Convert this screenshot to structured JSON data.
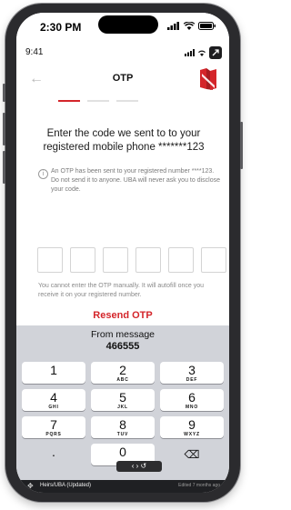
{
  "device": {
    "time": "2:30 PM"
  },
  "app_status": {
    "time": "9:41"
  },
  "header": {
    "back_icon": "back-arrow-icon",
    "title": "OTP",
    "logo_icon": "uba-logo-icon",
    "brand_color": "#d4252a"
  },
  "progress": {
    "steps": 3,
    "active_step": 1
  },
  "content": {
    "heading": "Enter the code we sent to to your registered mobile phone *******123",
    "info_text": "An OTP has been sent to your registered number ****123. Do not send it to anyone. UBA will never ask you to disclose your code.",
    "otp_length": 6,
    "note": "You cannot enter the OTP manually. It will autofill once you receive it on your registered number.",
    "resend_label": "Resend OTP"
  },
  "keyboard": {
    "suggestion_label": "From message",
    "suggestion_value": "466555",
    "keys": [
      {
        "num": "1",
        "letters": ""
      },
      {
        "num": "2",
        "letters": "ABC"
      },
      {
        "num": "3",
        "letters": "DEF"
      },
      {
        "num": "4",
        "letters": "GHI"
      },
      {
        "num": "5",
        "letters": "JKL"
      },
      {
        "num": "6",
        "letters": "MNO"
      },
      {
        "num": "7",
        "letters": "PQRS"
      },
      {
        "num": "8",
        "letters": "TUV"
      },
      {
        "num": "9",
        "letters": "WXYZ"
      },
      {
        "num": ".",
        "letters": ""
      },
      {
        "num": "0",
        "letters": ""
      },
      {
        "num": "⌫",
        "letters": ""
      }
    ],
    "cursor_controls": "‹ › ↺"
  },
  "bottom_bar": {
    "title": "Heirs/UBA (Updated)",
    "edited": "Edited 7 months ago"
  }
}
